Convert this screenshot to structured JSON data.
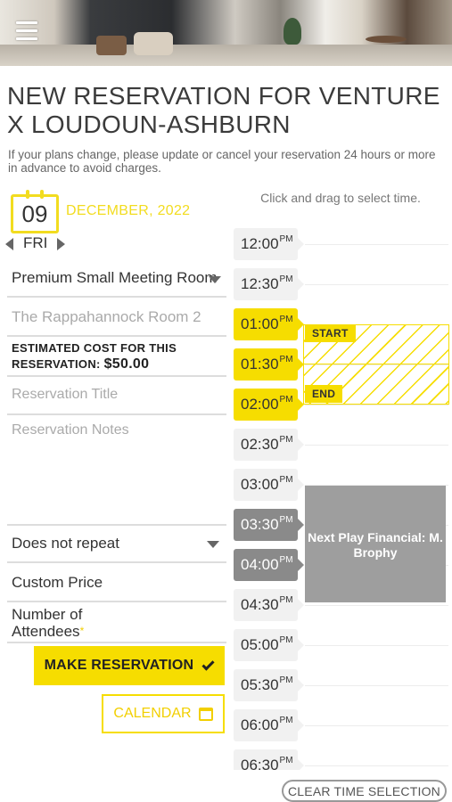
{
  "header": {
    "title": "NEW RESERVATION FOR VENTURE X LOUDOUN-ASHBURN",
    "notice": "If your plans change, please update or cancel your reservation 24 hours or more in advance to avoid charges."
  },
  "date": {
    "day": "09",
    "month_year": "DECEMBER, 2022",
    "weekday": "FRI"
  },
  "form": {
    "room_type": "Premium Small Meeting Room",
    "room": "The Rappahannock Room 2",
    "estimated_cost_label": "ESTIMATED COST FOR THIS RESERVATION:",
    "estimated_cost_value": "$50.00",
    "title_placeholder": "Reservation Title",
    "notes_placeholder": "Reservation Notes",
    "repeat": "Does not repeat",
    "custom_price": "Custom Price",
    "attendees_label": "Number of Attendees",
    "required_mark": "*"
  },
  "buttons": {
    "make": "MAKE RESERVATION",
    "calendar": "CALENDAR",
    "clear": "CLEAR TIME SELECTION"
  },
  "schedule": {
    "hint": "Click and drag to select time.",
    "slots": [
      {
        "time": "12:00",
        "ampm": "PM",
        "state": "free"
      },
      {
        "time": "12:30",
        "ampm": "PM",
        "state": "free"
      },
      {
        "time": "01:00",
        "ampm": "PM",
        "state": "selected"
      },
      {
        "time": "01:30",
        "ampm": "PM",
        "state": "selected"
      },
      {
        "time": "02:00",
        "ampm": "PM",
        "state": "selected"
      },
      {
        "time": "02:30",
        "ampm": "PM",
        "state": "free"
      },
      {
        "time": "03:00",
        "ampm": "PM",
        "state": "free"
      },
      {
        "time": "03:30",
        "ampm": "PM",
        "state": "busy"
      },
      {
        "time": "04:00",
        "ampm": "PM",
        "state": "busy"
      },
      {
        "time": "04:30",
        "ampm": "PM",
        "state": "free"
      },
      {
        "time": "05:00",
        "ampm": "PM",
        "state": "free"
      },
      {
        "time": "05:30",
        "ampm": "PM",
        "state": "free"
      },
      {
        "time": "06:00",
        "ampm": "PM",
        "state": "free"
      },
      {
        "time": "06:30",
        "ampm": "PM",
        "state": "free"
      }
    ],
    "start_label": "START",
    "end_label": "END",
    "booking_text": "Next Play Financial: M. Brophy"
  },
  "colors": {
    "accent": "#f6dd00",
    "busy": "#9e9e9e",
    "slot_bg": "#f1f1f1"
  },
  "icons": {
    "menu": "hamburger-menu-icon",
    "prev": "chevron-left-icon",
    "next": "chevron-right-icon",
    "dropdown": "caret-down-icon",
    "confirm": "checkmark-icon",
    "calendar": "calendar-icon"
  }
}
